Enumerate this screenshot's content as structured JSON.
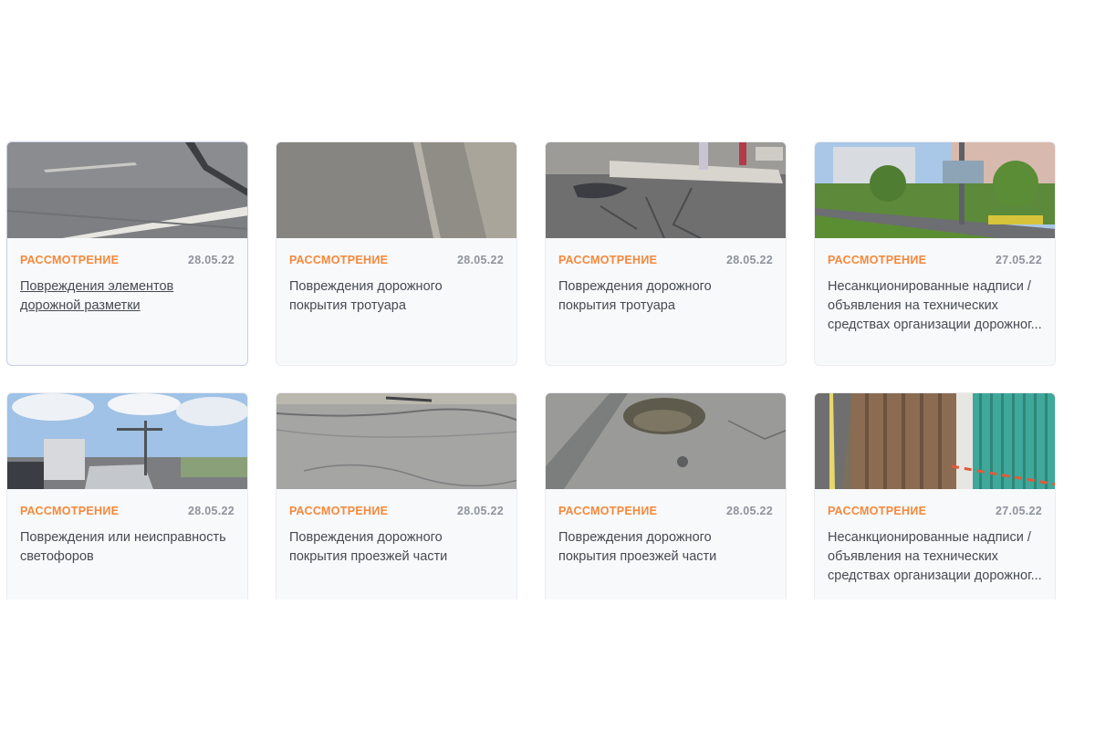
{
  "colors": {
    "status": "#f5883a",
    "date": "#8e939c",
    "title": "#454a52",
    "card_bg": "#f8f9fb"
  },
  "cards": [
    {
      "status": "РАССМОТРЕНИЕ",
      "date": "28.05.22",
      "title": "Повреждения элементов дорожной разметки"
    },
    {
      "status": "РАССМОТРЕНИЕ",
      "date": "28.05.22",
      "title": "Повреждения дорожного покрытия тротуара"
    },
    {
      "status": "РАССМОТРЕНИЕ",
      "date": "28.05.22",
      "title": "Повреждения дорожного покрытия тротуара"
    },
    {
      "status": "РАССМОТРЕНИЕ",
      "date": "27.05.22",
      "title": "Несанкционированные надписи / объявления на технических средствах организации дорожног..."
    },
    {
      "status": "РАССМОТРЕНИЕ",
      "date": "28.05.22",
      "title": "Повреждения или неисправность светофоров"
    },
    {
      "status": "РАССМОТРЕНИЕ",
      "date": "28.05.22",
      "title": "Повреждения дорожного покрытия проезжей части"
    },
    {
      "status": "РАССМОТРЕНИЕ",
      "date": "28.05.22",
      "title": "Повреждения дорожного покрытия проезжей части"
    },
    {
      "status": "РАССМОТРЕНИЕ",
      "date": "27.05.22",
      "title": "Несанкционированные надписи / объявления на технических средствах организации дорожног..."
    }
  ]
}
